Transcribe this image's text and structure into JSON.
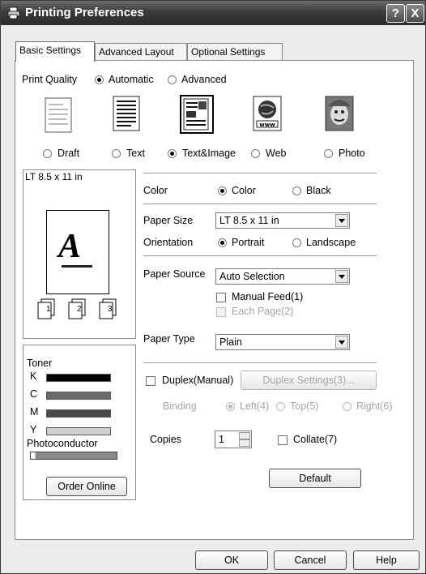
{
  "window": {
    "title": "Printing Preferences",
    "help_glyph": "?",
    "close_glyph": "X"
  },
  "tabs": [
    {
      "label": "Basic Settings",
      "active": true
    },
    {
      "label": "Advanced Layout",
      "active": false
    },
    {
      "label": "Optional Settings",
      "active": false
    }
  ],
  "print_quality": {
    "label": "Print Quality",
    "mode_options": [
      {
        "label": "Automatic",
        "selected": true
      },
      {
        "label": "Advanced",
        "selected": false
      }
    ],
    "types": [
      {
        "label": "Draft",
        "icon": "draft-document-icon",
        "selected": false
      },
      {
        "label": "Text",
        "icon": "text-document-icon",
        "selected": false
      },
      {
        "label": "Text&Image",
        "icon": "text-image-document-icon",
        "selected": true
      },
      {
        "label": "Web",
        "icon": "web-globe-icon",
        "selected": false
      },
      {
        "label": "Photo",
        "icon": "photo-portrait-icon",
        "selected": false
      }
    ]
  },
  "preview": {
    "paper_label": "LT 8.5 x 11 in",
    "letter": "A",
    "copy_numbers": [
      "1",
      "2",
      "3"
    ]
  },
  "toner": {
    "label": "Toner",
    "channels": [
      {
        "key": "K",
        "level": 1.0,
        "color": "#000000"
      },
      {
        "key": "C",
        "level": 1.0,
        "color": "#6a6a6a"
      },
      {
        "key": "M",
        "level": 1.0,
        "color": "#4a4a4a"
      },
      {
        "key": "Y",
        "level": 1.0,
        "color": "#cfcfcf"
      }
    ],
    "photoconductor_label": "Photoconductor",
    "photoconductor_level": 0.05,
    "order_button": "Order Online"
  },
  "color": {
    "label": "Color",
    "options": [
      {
        "label": "Color",
        "selected": true
      },
      {
        "label": "Black",
        "selected": false
      }
    ]
  },
  "paper_size": {
    "label": "Paper Size",
    "value": "LT 8.5 x 11 in"
  },
  "orientation": {
    "label": "Orientation",
    "options": [
      {
        "label": "Portrait",
        "selected": true
      },
      {
        "label": "Landscape",
        "selected": false
      }
    ]
  },
  "paper_source": {
    "label": "Paper Source",
    "value": "Auto Selection",
    "manual_feed": "Manual Feed(1)",
    "each_page": "Each Page(2)"
  },
  "paper_type": {
    "label": "Paper Type",
    "value": "Plain"
  },
  "duplex": {
    "label": "Duplex(Manual)",
    "settings_button": "Duplex Settings(3)...",
    "binding_label": "Binding",
    "binding_options": [
      {
        "label": "Left(4)",
        "selected": true
      },
      {
        "label": "Top(5)",
        "selected": false
      },
      {
        "label": "Right(6)",
        "selected": false
      }
    ]
  },
  "copies": {
    "label": "Copies",
    "value": "1",
    "collate": "Collate(7)"
  },
  "default_button": "Default",
  "footer": {
    "ok": "OK",
    "cancel": "Cancel",
    "help": "Help"
  }
}
